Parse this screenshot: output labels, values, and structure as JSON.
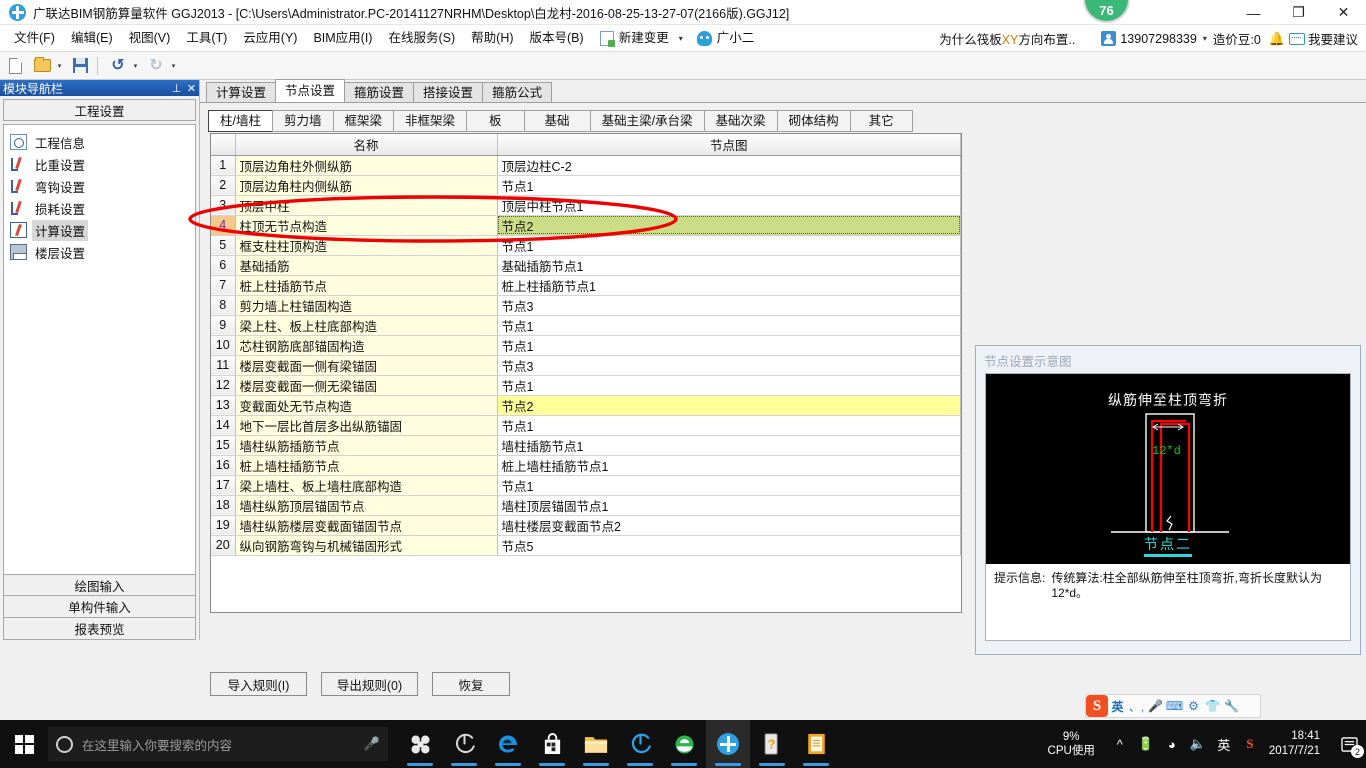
{
  "window": {
    "title": "广联达BIM钢筋算量软件 GGJ2013 - [C:\\Users\\Administrator.PC-20141127NRHM\\Desktop\\白龙村-2016-08-25-13-27-07(2166版).GGJ12]",
    "app_icon": "guanglianda-icon",
    "minimize": "—",
    "maximize": "❐",
    "close": "✕",
    "score_badge": "76"
  },
  "menubar": {
    "items": [
      {
        "label": "文件(F)"
      },
      {
        "label": "编辑(E)"
      },
      {
        "label": "视图(V)"
      },
      {
        "label": "工具(T)"
      },
      {
        "label": "云应用(Y)"
      },
      {
        "label": "BIM应用(I)"
      },
      {
        "label": "在线服务(S)"
      },
      {
        "label": "帮助(H)"
      },
      {
        "label": "版本号(B)"
      }
    ],
    "new_change": "新建变更",
    "new_change_caret": "▾",
    "assistant": "广小二",
    "promo_a": "为什么筏板",
    "promo_xy": "XY",
    "promo_b": "方向布置..",
    "phone": "13907298339",
    "phone_caret": "▾",
    "beans": "造价豆:0",
    "suggestion": "我要建议"
  },
  "toolbar": {
    "new": "new-file-icon",
    "open": "open-folder-icon",
    "save": "save-icon",
    "undo": "↺",
    "redo": "↻",
    "caret": "▾"
  },
  "navpanel": {
    "title": "模块导航栏",
    "pin": "⊥",
    "close": "✕",
    "section": "工程设置",
    "items": [
      {
        "label": "工程信息",
        "icon": "project-info-icon",
        "active": false
      },
      {
        "label": "比重设置",
        "icon": "weight-settings-icon",
        "active": false
      },
      {
        "label": "弯钩设置",
        "icon": "hook-settings-icon",
        "active": false
      },
      {
        "label": "损耗设置",
        "icon": "loss-settings-icon",
        "active": false
      },
      {
        "label": "计算设置",
        "icon": "calc-settings-icon",
        "active": true
      },
      {
        "label": "楼层设置",
        "icon": "floor-settings-icon",
        "active": false
      }
    ],
    "bottom_buttons": [
      {
        "label": "绘图输入"
      },
      {
        "label": "单构件输入"
      },
      {
        "label": "报表预览"
      }
    ]
  },
  "tabs_primary": [
    {
      "label": "计算设置",
      "active": false
    },
    {
      "label": "节点设置",
      "active": true
    },
    {
      "label": "箍筋设置",
      "active": false
    },
    {
      "label": "搭接设置",
      "active": false
    },
    {
      "label": "箍筋公式",
      "active": false
    }
  ],
  "tabs_secondary": [
    {
      "label": "柱/墙柱",
      "active": true
    },
    {
      "label": "剪力墙",
      "active": false
    },
    {
      "label": "框架梁",
      "active": false
    },
    {
      "label": "非框架梁",
      "active": false
    },
    {
      "label": "板",
      "active": false
    },
    {
      "label": "基础",
      "active": false
    },
    {
      "label": "基础主梁/承台梁",
      "active": false
    },
    {
      "label": "基础次梁",
      "active": false
    },
    {
      "label": "砌体结构",
      "active": false
    },
    {
      "label": "其它",
      "active": false
    }
  ],
  "table": {
    "columns": [
      "",
      "名称",
      "节点图"
    ],
    "rows": [
      {
        "idx": "1",
        "name": "顶层边角柱外侧纵筋",
        "node": "顶层边柱C-2",
        "state": "normal"
      },
      {
        "idx": "2",
        "name": "顶层边角柱内侧纵筋",
        "node": "节点1",
        "state": "normal"
      },
      {
        "idx": "3",
        "name": "顶层中柱",
        "node": "顶层中柱节点1",
        "state": "normal"
      },
      {
        "idx": "4",
        "name": "柱顶无节点构造",
        "node": "节点2",
        "state": "selected"
      },
      {
        "idx": "5",
        "name": "框支柱柱顶构造",
        "node": "节点1",
        "state": "normal"
      },
      {
        "idx": "6",
        "name": "基础插筋",
        "node": "基础插筋节点1",
        "state": "normal"
      },
      {
        "idx": "7",
        "name": "桩上柱插筋节点",
        "node": "桩上柱插筋节点1",
        "state": "normal"
      },
      {
        "idx": "8",
        "name": "剪力墙上柱锚固构造",
        "node": "节点3",
        "state": "normal"
      },
      {
        "idx": "9",
        "name": "梁上柱、板上柱底部构造",
        "node": "节点1",
        "state": "normal"
      },
      {
        "idx": "10",
        "name": "芯柱钢筋底部锚固构造",
        "node": "节点1",
        "state": "normal"
      },
      {
        "idx": "11",
        "name": "楼层变截面一侧有梁锚固",
        "node": "节点3",
        "state": "normal"
      },
      {
        "idx": "12",
        "name": "楼层变截面一侧无梁锚固",
        "node": "节点1",
        "state": "normal"
      },
      {
        "idx": "13",
        "name": "变截面处无节点构造",
        "node": "节点2",
        "state": "highlight"
      },
      {
        "idx": "14",
        "name": "地下一层比首层多出纵筋锚固",
        "node": "节点1",
        "state": "normal"
      },
      {
        "idx": "15",
        "name": "墙柱纵筋插筋节点",
        "node": "墙柱插筋节点1",
        "state": "normal"
      },
      {
        "idx": "16",
        "name": "桩上墙柱插筋节点",
        "node": "桩上墙柱插筋节点1",
        "state": "normal"
      },
      {
        "idx": "17",
        "name": "梁上墙柱、板上墙柱底部构造",
        "node": "节点1",
        "state": "normal"
      },
      {
        "idx": "18",
        "name": "墙柱纵筋顶层锚固节点",
        "node": "墙柱顶层锚固节点1",
        "state": "normal"
      },
      {
        "idx": "19",
        "name": "墙柱纵筋楼层变截面锚固节点",
        "node": "墙柱楼层变截面节点2",
        "state": "normal"
      },
      {
        "idx": "20",
        "name": "纵向钢筋弯钩与机械锚固形式",
        "node": "节点5",
        "state": "normal"
      }
    ]
  },
  "diagram": {
    "panel_title": "节点设置示意图",
    "heading": "纵筋伸至柱顶弯折",
    "dim_label": "12*d",
    "caption": "节点二",
    "tip_label": "提示信息:",
    "tip_text": "传统算法:柱全部纵筋伸至柱顶弯折,弯折长度默认为12*d。"
  },
  "footer_buttons": [
    {
      "label": "导入规则(I)"
    },
    {
      "label": "导出规则(0)"
    },
    {
      "label": "恢复"
    }
  ],
  "ime": {
    "logo": "S",
    "items": [
      "英",
      "、,",
      "mic-icon",
      "keyboard-icon",
      "toolbox-icon",
      "skin-icon",
      "wrench-icon"
    ]
  },
  "taskbar": {
    "start": "windows-start-icon",
    "search_placeholder": "在这里输入你要搜索的内容",
    "mic": "microphone-icon",
    "apps": [
      {
        "name": "sogou-browser-icon",
        "running": true
      },
      {
        "name": "tencent-qq-browser-icon",
        "running": true
      },
      {
        "name": "microsoft-edge-icon",
        "running": true
      },
      {
        "name": "microsoft-store-icon",
        "running": true
      },
      {
        "name": "file-explorer-icon",
        "running": true
      },
      {
        "name": "360-browser-icon",
        "running": true
      },
      {
        "name": "ie-browser-icon",
        "running": true
      },
      {
        "name": "guanglianda-icon",
        "running": true,
        "active": true
      },
      {
        "name": "help-doc-icon",
        "running": true
      },
      {
        "name": "notepad-icon",
        "running": true
      }
    ],
    "cpu_value": "9%",
    "cpu_label": "CPU使用",
    "tray": [
      "^",
      "battery-icon",
      "wifi-icon",
      "volume-icon",
      "英",
      "sogou-ime-icon"
    ],
    "time": "18:41",
    "date": "2017/7/21",
    "notifications": "2"
  }
}
